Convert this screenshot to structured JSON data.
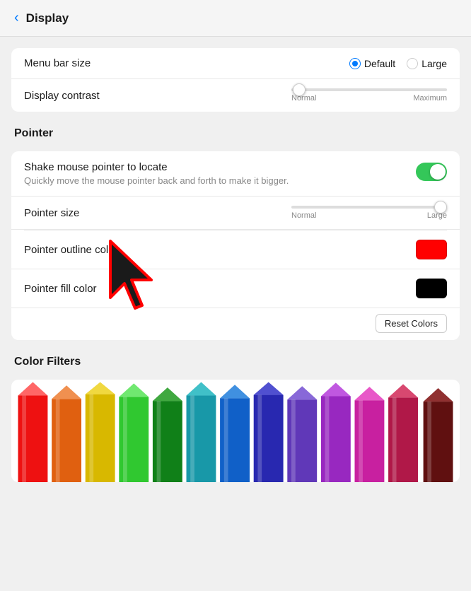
{
  "header": {
    "back_label": "‹",
    "title": "Display"
  },
  "sections": {
    "menu_bar": {
      "label": "Menu bar size",
      "options": [
        {
          "label": "Default",
          "selected": true
        },
        {
          "label": "Large",
          "selected": false
        }
      ]
    },
    "display_contrast": {
      "label": "Display contrast",
      "slider_min": "Normal",
      "slider_max": "Maximum"
    },
    "pointer_heading": "Pointer",
    "shake_mouse": {
      "label": "Shake mouse pointer to locate",
      "sublabel": "Quickly move the mouse pointer back and forth to make it bigger.",
      "enabled": true
    },
    "pointer_size": {
      "label": "Pointer size",
      "slider_min": "Normal",
      "slider_max": "Large"
    },
    "pointer_outline": {
      "label": "Pointer outline color",
      "color": "#FF0000"
    },
    "pointer_fill": {
      "label": "Pointer fill color",
      "color": "#000000"
    },
    "reset_colors": {
      "label": "Reset Colors"
    },
    "color_filters_heading": "Color Filters"
  },
  "pencils": [
    {
      "color": "#EE1111",
      "light": "#FF5555"
    },
    {
      "color": "#E06010",
      "light": "#F08040"
    },
    {
      "color": "#E8C010",
      "light": "#F0D040"
    },
    {
      "color": "#30C030",
      "light": "#60E060"
    },
    {
      "color": "#108018",
      "light": "#30A830"
    },
    {
      "color": "#2090A0",
      "light": "#40B8C0"
    },
    {
      "color": "#1060C8",
      "light": "#3090E0"
    },
    {
      "color": "#3030B0",
      "light": "#5050D0"
    },
    {
      "color": "#6040B8",
      "light": "#8060D8"
    },
    {
      "color": "#A030C0",
      "light": "#C050E0"
    },
    {
      "color": "#C820A0",
      "light": "#E050C0"
    },
    {
      "color": "#B01850",
      "light": "#D04070"
    },
    {
      "color": "#601010",
      "light": "#903030"
    }
  ]
}
